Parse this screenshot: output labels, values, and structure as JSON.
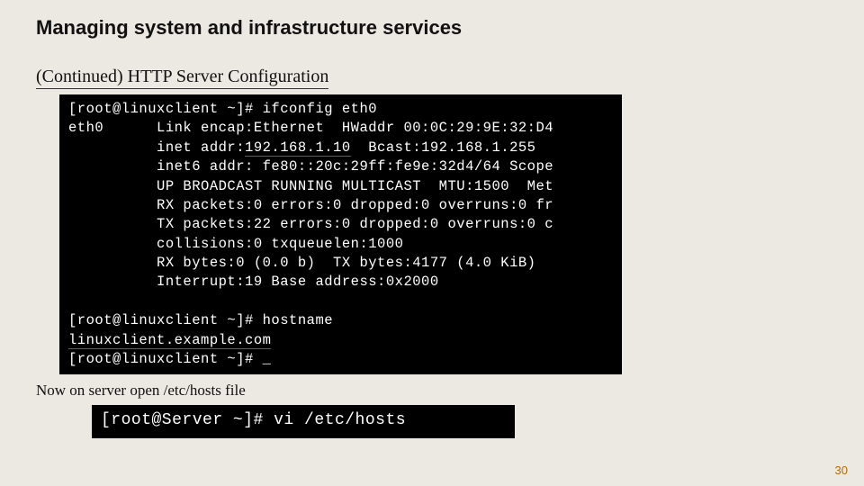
{
  "title": "Managing system and infrastructure services",
  "subtitle": "(Continued) HTTP Server Configuration",
  "terminal1": {
    "l1a": "[root@linuxclient ~]# ifconfig eth0",
    "l2a": "eth0      Link encap:Ethernet  HWaddr 00:0C:29:9E:32:D4",
    "l3a": "          inet addr:",
    "l3b": "192.168.1.10",
    "l3c": "  Bcast:192.168.1.255",
    "l4a": "          inet6 addr: fe80::20c:29ff:fe9e:32d4/64 Scope",
    "l5a": "          UP BROADCAST RUNNING MULTICAST  MTU:1500  Met",
    "l6a": "          RX packets:0 errors:0 dropped:0 overruns:0 fr",
    "l7a": "          TX packets:22 errors:0 dropped:0 overruns:0 c",
    "l8a": "          collisions:0 txqueuelen:1000",
    "l9a": "          RX bytes:0 (0.0 b)  TX bytes:4177 (4.0 KiB)",
    "l10a": "          Interrupt:19 Base address:0x2000",
    "blank": "",
    "l11a": "[root@linuxclient ~]# hostname",
    "l12a": "linuxclient.example.com",
    "l13a": "[root@linuxclient ~]# _"
  },
  "caption": "Now on server open /etc/hosts file",
  "terminal2": {
    "line": "[root@Server ~]# vi /etc/hosts"
  },
  "pagenum": "30"
}
